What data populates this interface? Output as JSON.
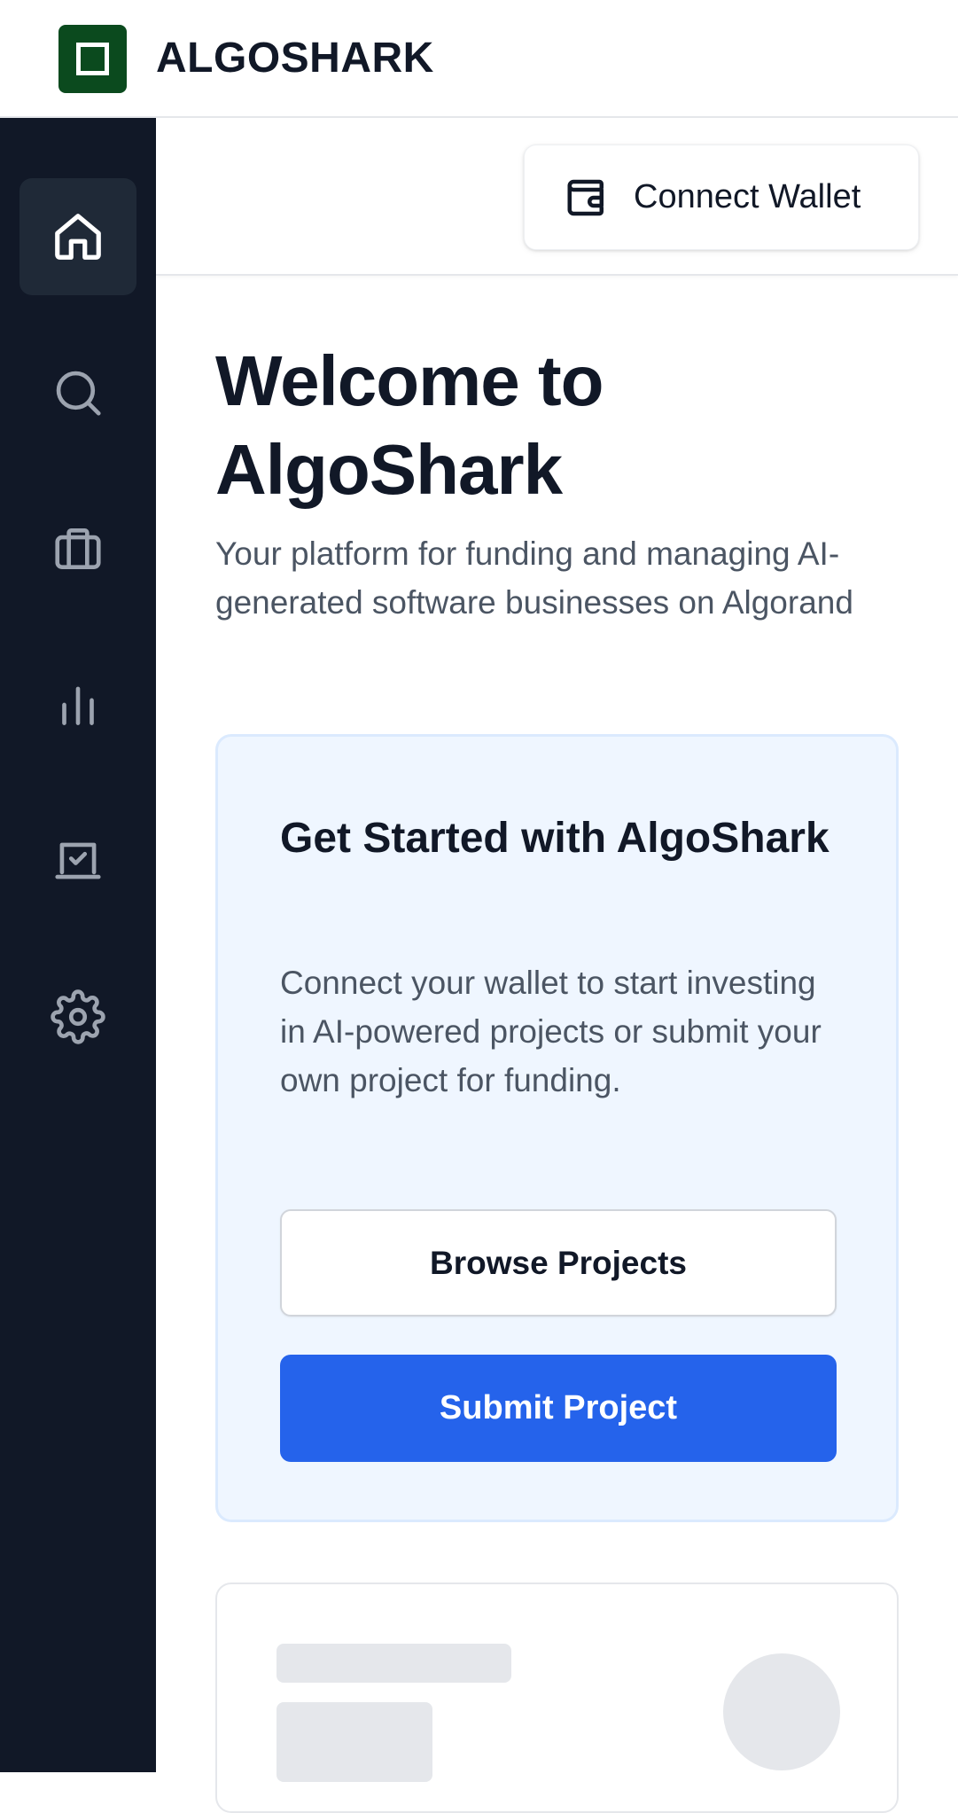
{
  "header": {
    "brand": "ALGOSHARK",
    "logo_color": "#0b4a1e"
  },
  "sidebar": {
    "items": [
      {
        "icon": "home-icon",
        "active": true
      },
      {
        "icon": "search-icon",
        "active": false
      },
      {
        "icon": "briefcase-icon",
        "active": false
      },
      {
        "icon": "bar-chart-icon",
        "active": false
      },
      {
        "icon": "laptop-check-icon",
        "active": false
      },
      {
        "icon": "gear-icon",
        "active": false
      }
    ]
  },
  "topbar": {
    "connect_wallet_label": "Connect Wallet",
    "connect_wallet_icon": "wallet-icon"
  },
  "main": {
    "title": "Welcome to AlgoShark",
    "subtitle": "Your platform for funding and managing AI-generated software businesses on Algorand"
  },
  "get_started": {
    "title": "Get Started with AlgoShark",
    "text": "Connect your wallet to start investing in AI-powered projects or submit your own project for funding.",
    "browse_label": "Browse Projects",
    "submit_label": "Submit Project"
  },
  "colors": {
    "sidebar_bg": "#111827",
    "accent": "#2563eb",
    "card_bg": "#eff6ff"
  }
}
